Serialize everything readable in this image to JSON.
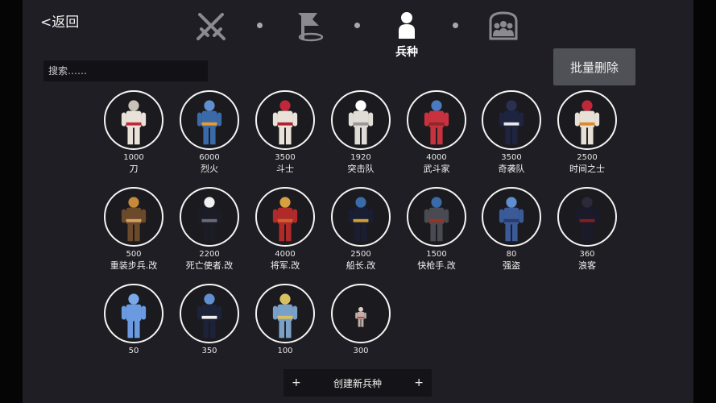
{
  "nav": {
    "back_label": "<返回",
    "active_label": "兵种",
    "icons": [
      "crossed-swords-icon",
      "flag-icon",
      "person-icon",
      "crowd-icon"
    ]
  },
  "search": {
    "placeholder": "搜索……"
  },
  "bulk_delete_label": "批量删除",
  "create_button": {
    "label": "创建新兵种",
    "left_plus": "+",
    "right_plus": "+"
  },
  "colors": {
    "background": "#1f1e24",
    "circle_border": "#f4f4f4",
    "button": "#505057"
  },
  "units": [
    {
      "cost": "1000",
      "name": "刀",
      "figure": "white-red-icon"
    },
    {
      "cost": "6000",
      "name": "烈火",
      "figure": "blue-fire-icon"
    },
    {
      "cost": "3500",
      "name": "斗士",
      "figure": "white-red-horn-icon"
    },
    {
      "cost": "1920",
      "name": "突击队",
      "figure": "white-hat-icon"
    },
    {
      "cost": "4000",
      "name": "武斗家",
      "figure": "red-fighter-icon"
    },
    {
      "cost": "3500",
      "name": "奇袭队",
      "figure": "dark-ninja-icon"
    },
    {
      "cost": "2500",
      "name": "时间之士",
      "figure": "white-red-orange-icon"
    },
    {
      "cost": "500",
      "name": "重装步兵.改",
      "figure": "shield-spear-icon"
    },
    {
      "cost": "2200",
      "name": "死亡使者.改",
      "figure": "dark-reaper-icon"
    },
    {
      "cost": "4000",
      "name": "将军.改",
      "figure": "red-general-icon"
    },
    {
      "cost": "2500",
      "name": "船长.改",
      "figure": "dark-captain-icon"
    },
    {
      "cost": "1500",
      "name": "快枪手.改",
      "figure": "gunslinger-icon"
    },
    {
      "cost": "80",
      "name": "强盗",
      "figure": "blue-bandit-icon"
    },
    {
      "cost": "360",
      "name": "浪客",
      "figure": "dark-wanderer-icon"
    },
    {
      "cost": "50",
      "name": "",
      "figure": "blue-plain-icon"
    },
    {
      "cost": "350",
      "name": "",
      "figure": "dark-suit-icon"
    },
    {
      "cost": "100",
      "name": "",
      "figure": "small-yellow-icon"
    },
    {
      "cost": "300",
      "name": "",
      "figure": "tiny-figure-icon"
    }
  ]
}
